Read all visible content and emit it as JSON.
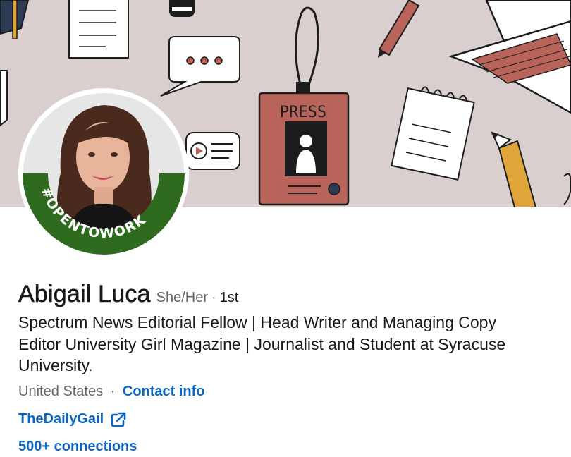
{
  "banner": {
    "press_badge_text": "PRESS",
    "background_color": "#d9cfcf",
    "accent_color": "#b8645a"
  },
  "profile": {
    "open_to_work_text": "#OPENTOWORK",
    "open_to_work_color": "#2f6b1f",
    "name": "Abigail Luca",
    "pronouns": "She/Her",
    "degree_separator": "·",
    "connection_degree": "1st",
    "headline": "Spectrum News Editorial Fellow | Head Writer and Managing Copy Editor University Girl Magazine | Journalist and Student at Syracuse University.",
    "location": "United States",
    "location_separator": "·",
    "contact_info_label": "Contact info",
    "website_label": "TheDailyGail",
    "website_icon": "external-link-icon",
    "connections_label": "500+ connections",
    "link_color": "#0a66c2"
  }
}
